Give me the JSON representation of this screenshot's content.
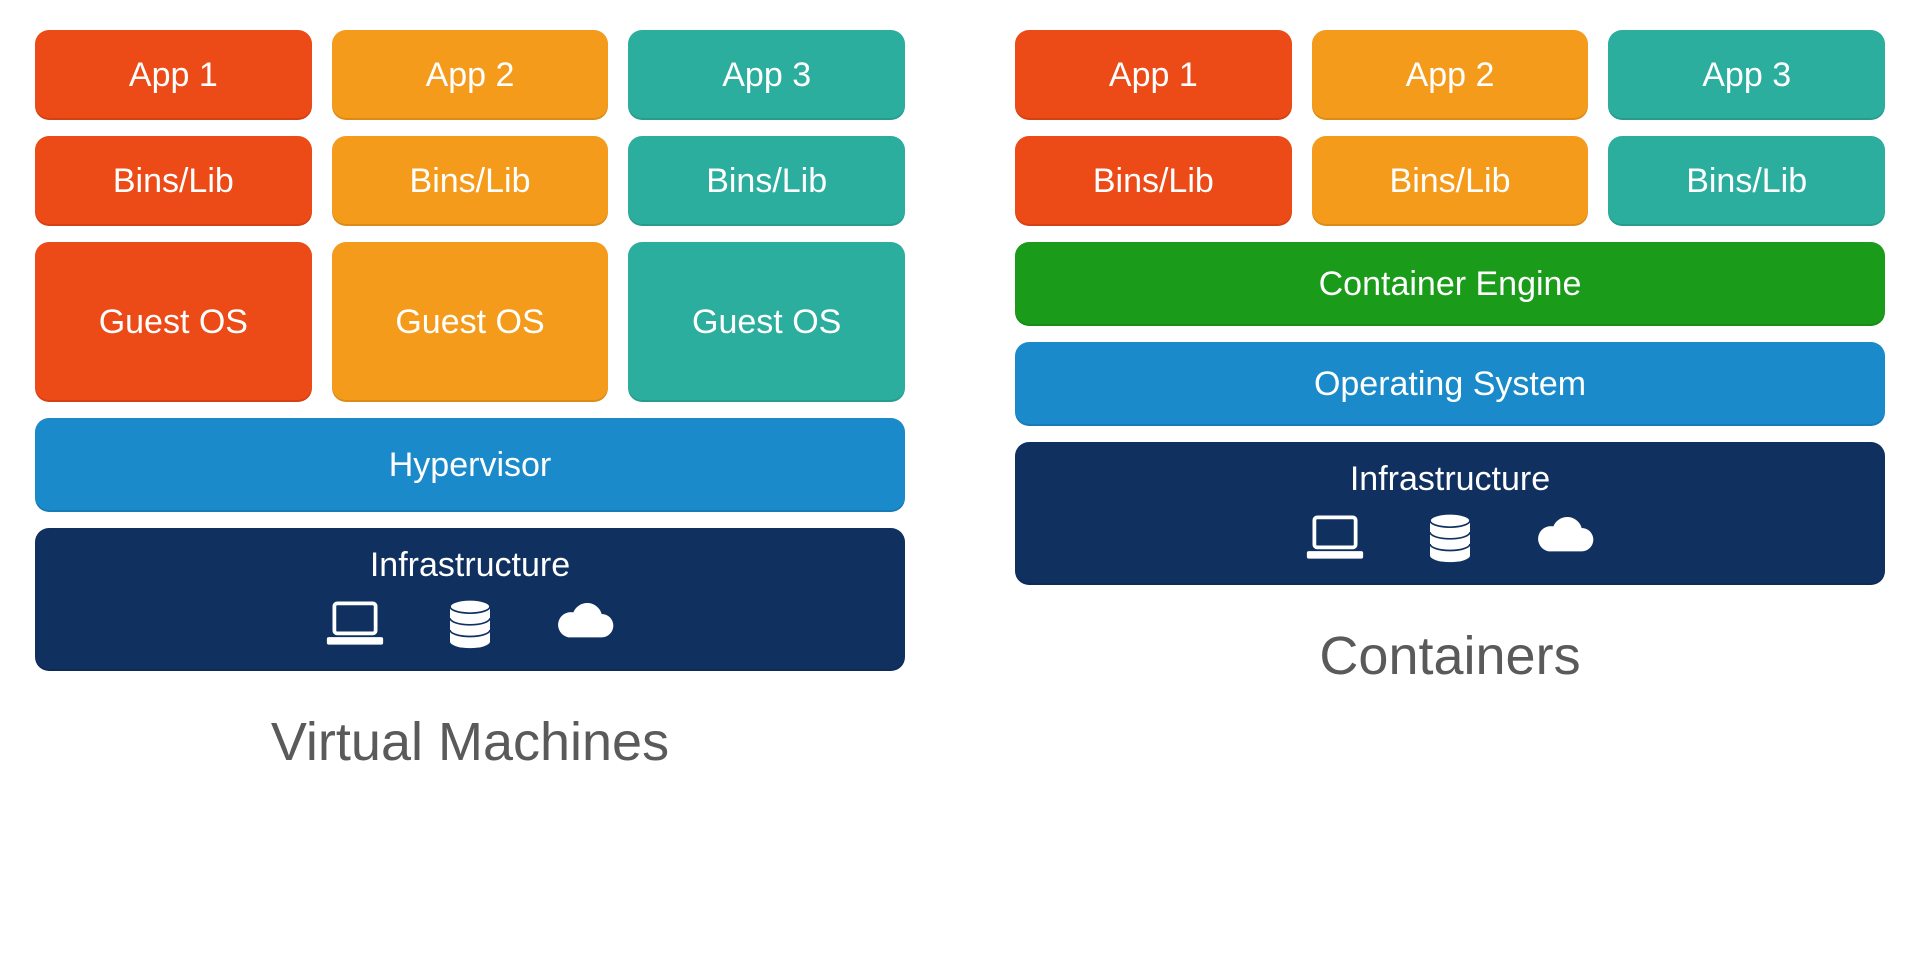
{
  "colors": {
    "orange_deep": "#ec4a16",
    "orange": "#f59b1c",
    "teal": "#2cae9f",
    "blue": "#1a8acb",
    "navy": "#10305f",
    "green": "#1a9c1a"
  },
  "vm": {
    "title": "Virtual Machines",
    "apps": [
      "App 1",
      "App 2",
      "App 3"
    ],
    "bins": [
      "Bins/Lib",
      "Bins/Lib",
      "Bins/Lib"
    ],
    "guest": [
      "Guest OS",
      "Guest OS",
      "Guest OS"
    ],
    "hypervisor": "Hypervisor",
    "infrastructure": "Infrastructure"
  },
  "containers": {
    "title": "Containers",
    "apps": [
      "App 1",
      "App 2",
      "App 3"
    ],
    "bins": [
      "Bins/Lib",
      "Bins/Lib",
      "Bins/Lib"
    ],
    "engine": "Container Engine",
    "os": "Operating System",
    "infrastructure": "Infrastructure"
  },
  "icons": {
    "laptop": "laptop-icon",
    "database": "database-icon",
    "cloud": "cloud-icon"
  }
}
